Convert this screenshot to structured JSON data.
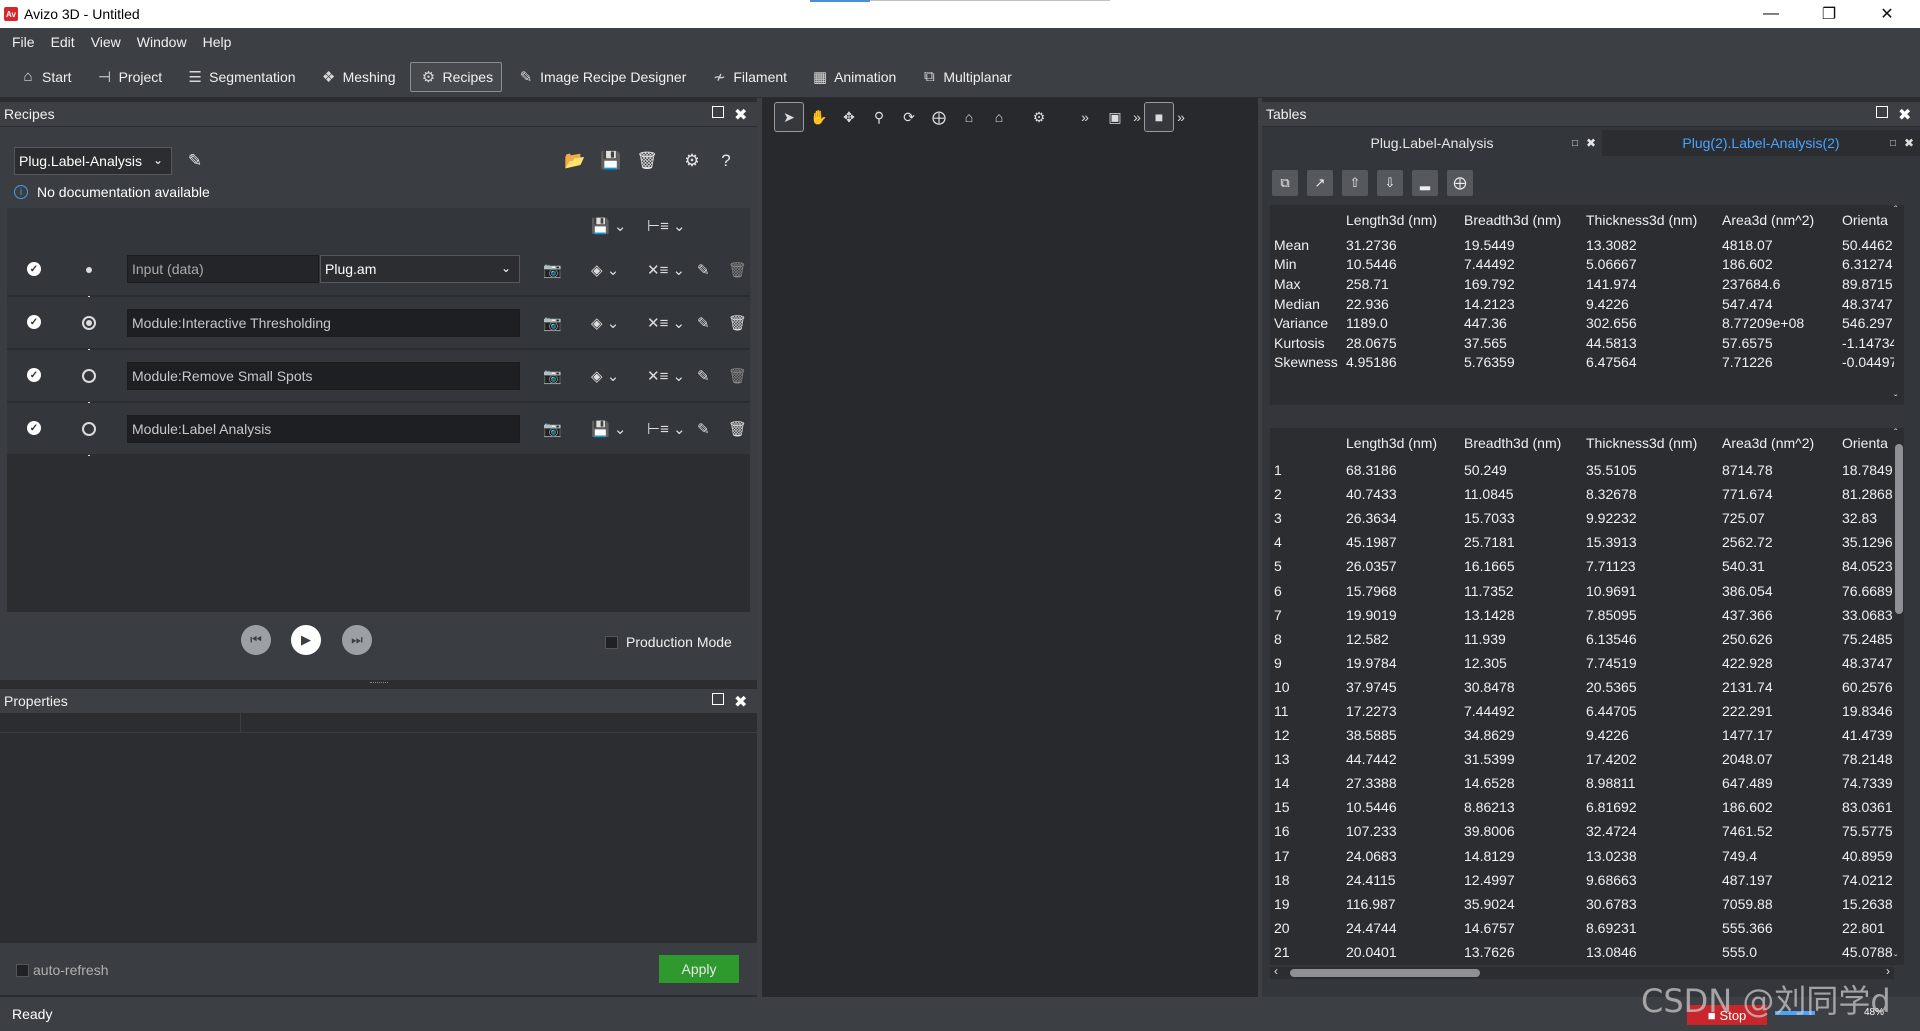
{
  "window": {
    "title": "Avizo 3D - Untitled",
    "logo": "Av"
  },
  "menu": [
    "File",
    "Edit",
    "View",
    "Window",
    "Help"
  ],
  "toolbar": [
    {
      "label": "Start",
      "icon": "home-icon"
    },
    {
      "label": "Project",
      "icon": "project-icon"
    },
    {
      "label": "Segmentation",
      "icon": "layers-icon"
    },
    {
      "label": "Meshing",
      "icon": "mesh-icon"
    },
    {
      "label": "Recipes",
      "icon": "gears-icon",
      "active": true
    },
    {
      "label": "Image Recipe Designer",
      "icon": "designer-icon"
    },
    {
      "label": "Filament",
      "icon": "filament-icon"
    },
    {
      "label": "Animation",
      "icon": "film-icon"
    },
    {
      "label": "Multiplanar",
      "icon": "multiplanar-icon"
    }
  ],
  "recipes": {
    "title": "Recipes",
    "selected_recipe": "Plug.Label-Analysis",
    "doc_text": "No documentation available",
    "steps": [
      {
        "module": "Input (data)",
        "data": "Plug.am"
      },
      {
        "module": "Module:Interactive Thresholding"
      },
      {
        "module": "Module:Remove Small Spots"
      },
      {
        "module": "Module:Label Analysis"
      }
    ],
    "production_mode": "Production Mode"
  },
  "properties": {
    "title": "Properties",
    "auto_refresh": "auto-refresh",
    "apply": "Apply"
  },
  "status": {
    "text": "Ready",
    "stop": "Stop",
    "percent": "48%"
  },
  "tables": {
    "title": "Tables",
    "tabs": [
      "Plug.Label-Analysis",
      "Plug(2).Label-Analysis(2)"
    ],
    "accent": "#4aa3ff",
    "columns": [
      "Length3d (nm)",
      "Breadth3d (nm)",
      "Thickness3d (nm)",
      "Area3d (nm^2)",
      "Orienta"
    ],
    "stats": [
      [
        "Mean",
        "31.2736",
        "19.5449",
        "13.3082",
        "4818.07",
        "50.4462"
      ],
      [
        "Min",
        "10.5446",
        "7.44492",
        "5.06667",
        "186.602",
        "6.31274"
      ],
      [
        "Max",
        "258.71",
        "169.792",
        "141.974",
        "237684.6",
        "89.8715"
      ],
      [
        "Median",
        "22.936",
        "14.2123",
        "9.4226",
        "547.474",
        "48.3747"
      ],
      [
        "Variance",
        "1189.0",
        "447.36",
        "302.656",
        "8.77209e+08",
        "546.297"
      ],
      [
        "Kurtosis",
        "28.0675",
        "37.565",
        "44.5813",
        "57.6575",
        "-1.14734"
      ],
      [
        "Skewness",
        "4.95186",
        "5.76359",
        "6.47564",
        "7.71226",
        "-0.04497"
      ]
    ],
    "rows": [
      [
        "1",
        "68.3186",
        "50.249",
        "35.5105",
        "8714.78",
        "18.7849"
      ],
      [
        "2",
        "40.7433",
        "11.0845",
        "8.32678",
        "771.674",
        "81.2868"
      ],
      [
        "3",
        "26.3634",
        "15.7033",
        "9.92232",
        "725.07",
        "32.83"
      ],
      [
        "4",
        "45.1987",
        "25.7181",
        "15.3913",
        "2562.72",
        "35.1296"
      ],
      [
        "5",
        "26.0357",
        "16.1665",
        "7.71123",
        "540.31",
        "84.0523"
      ],
      [
        "6",
        "15.7968",
        "11.7352",
        "10.9691",
        "386.054",
        "76.6689"
      ],
      [
        "7",
        "19.9019",
        "13.1428",
        "7.85095",
        "437.366",
        "33.0683"
      ],
      [
        "8",
        "12.582",
        "11.939",
        "6.13546",
        "250.626",
        "75.2485"
      ],
      [
        "9",
        "19.9784",
        "12.305",
        "7.74519",
        "422.928",
        "48.3747"
      ],
      [
        "10",
        "37.9745",
        "30.8478",
        "20.5365",
        "2131.74",
        "60.2576"
      ],
      [
        "11",
        "17.2273",
        "7.44492",
        "6.44705",
        "222.291",
        "19.8346"
      ],
      [
        "12",
        "38.5885",
        "34.8629",
        "9.4226",
        "1477.17",
        "41.4739"
      ],
      [
        "13",
        "44.7442",
        "31.5399",
        "17.4202",
        "2048.07",
        "78.2148"
      ],
      [
        "14",
        "27.3388",
        "14.6528",
        "8.98811",
        "647.489",
        "74.7339"
      ],
      [
        "15",
        "10.5446",
        "8.86213",
        "6.81692",
        "186.602",
        "83.0361"
      ],
      [
        "16",
        "107.233",
        "39.8006",
        "32.4724",
        "7461.52",
        "75.5775"
      ],
      [
        "17",
        "24.0683",
        "14.8129",
        "13.0238",
        "749.4",
        "40.8959"
      ],
      [
        "18",
        "24.4115",
        "12.4997",
        "9.68663",
        "487.197",
        "74.0212"
      ],
      [
        "19",
        "116.987",
        "35.9024",
        "30.6783",
        "7059.88",
        "15.2638"
      ],
      [
        "20",
        "24.4744",
        "14.6757",
        "8.69231",
        "555.366",
        "22.801"
      ],
      [
        "21",
        "20.0401",
        "13.7626",
        "13.0846",
        "555.0",
        "45.0788"
      ]
    ]
  },
  "watermark": "CSDN @刘同学d"
}
